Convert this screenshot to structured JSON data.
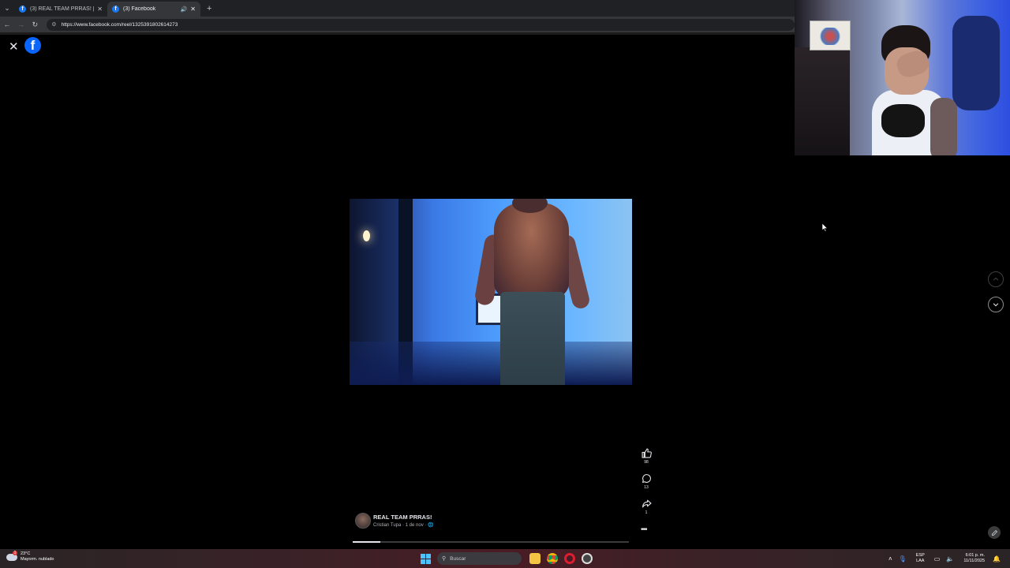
{
  "browser": {
    "tabs": [
      {
        "title": "(3) REAL TEAM PRRAS! | Facebo"
      },
      {
        "title": "(3) Facebook"
      }
    ],
    "url": "https://www.facebook.com/reel/1325391802614273"
  },
  "reel": {
    "likes": "98",
    "comments": "13",
    "shares": "1",
    "author_name": "REAL TEAM PRRAS!",
    "author_sub": "Cristian Tupa · 1 de nov · 🌐",
    "progress": 0.1
  },
  "taskbar": {
    "weather_temp": "23°C",
    "weather_desc": "Mayorm. nublado",
    "weather_badge": "1",
    "search_placeholder": "Buscar",
    "lang_line1": "ESP",
    "lang_line2": "LAA",
    "time": "6:01 p. m.",
    "date": "11/11/2025"
  }
}
